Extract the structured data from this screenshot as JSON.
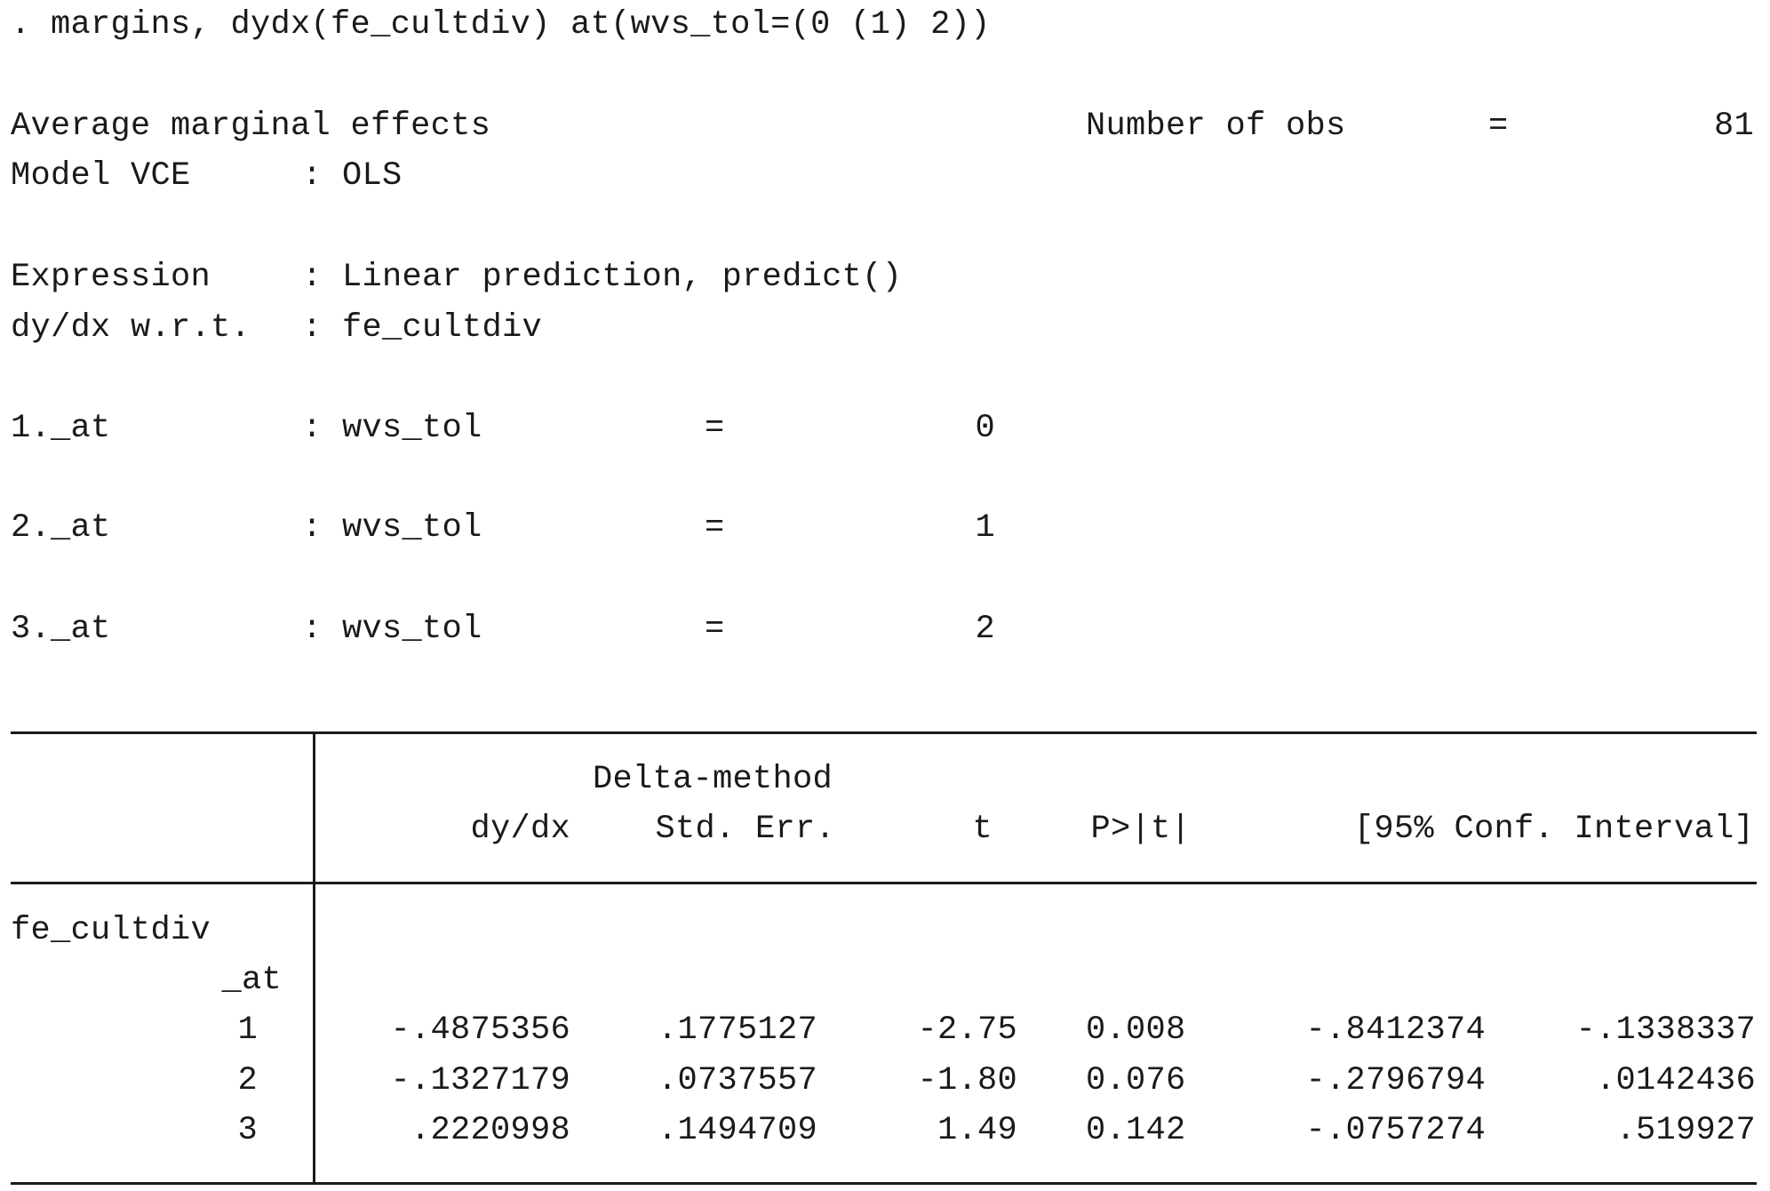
{
  "command": ". margins, dydx(fe_cultdiv) at(wvs_tol=(0 (1) 2))",
  "header": {
    "title": "Average marginal effects",
    "nobs_label": "Number of obs",
    "nobs_eq": "=",
    "nobs_value": "81",
    "model_vce_label": "Model VCE",
    "model_vce_value": ": OLS",
    "expression_label": "Expression",
    "expression_value": ": Linear prediction, predict()",
    "dydx_label": "dy/dx w.r.t.",
    "dydx_value": ": fe_cultdiv"
  },
  "at_rows": [
    {
      "label": "1._at",
      "var": ": wvs_tol",
      "eq": "=",
      "value": "0"
    },
    {
      "label": "2._at",
      "var": ": wvs_tol",
      "eq": "=",
      "value": "1"
    },
    {
      "label": "3._at",
      "var": ": wvs_tol",
      "eq": "=",
      "value": "2"
    }
  ],
  "table": {
    "super_header": "Delta-method",
    "columns": [
      "dy/dx",
      "Std. Err.",
      "t",
      "P>|t|",
      "[95% Conf. Interval]"
    ],
    "group_label": "fe_cultdiv",
    "sub_label": "_at",
    "rows": [
      {
        "at": "1",
        "dydx": "-.4875356",
        "se": ".1775127",
        "t": "-2.75",
        "p": "0.008",
        "ci_low": "-.8412374",
        "ci_high": "-.1338337"
      },
      {
        "at": "2",
        "dydx": "-.1327179",
        "se": ".0737557",
        "t": "-1.80",
        "p": "0.076",
        "ci_low": "-.2796794",
        "ci_high": ".0142436"
      },
      {
        "at": "3",
        "dydx": ".2220998",
        "se": ".1494709",
        "t": "1.49",
        "p": "0.142",
        "ci_low": "-.0757274",
        "ci_high": ".519927"
      }
    ]
  }
}
